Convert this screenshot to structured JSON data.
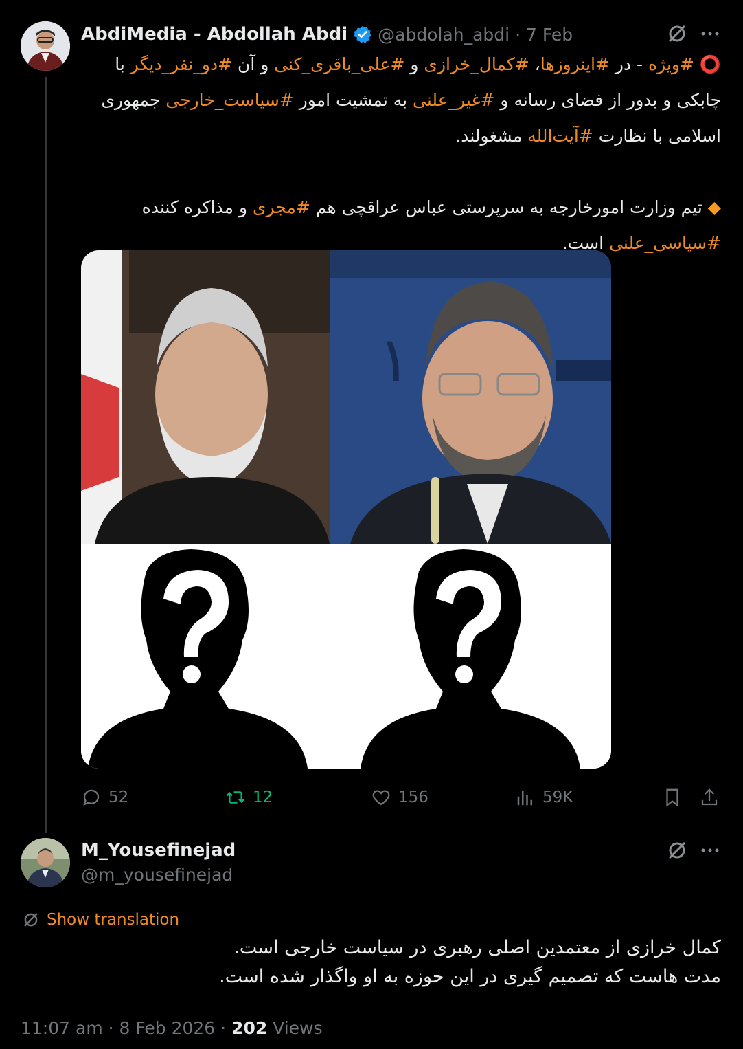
{
  "tweet": {
    "display_name": "AbdiMedia - Abdollah Abdi",
    "handle": "@abdolah_abdi",
    "dot": "·",
    "date": "7 Feb",
    "text": {
      "l1_icon": "⭕",
      "l1_a": " #ویژه",
      "l1_b": " -  در ",
      "l1_c": "#اینروزها",
      "l1_d": "، ",
      "l1_e": "#کمال_خرازی",
      "l1_f": " و ",
      "l1_g": "#علی_باقری_کنی",
      "l1_h": " و آن ",
      "l1_i": "#دو_نفر_دیگر",
      "l1_j": " با",
      "l2_a": "چابکی و بدور از فضای رسانه و ",
      "l2_b": "#غیر_علنی",
      "l2_c": " به تمشیت امور ",
      "l2_d": "#سیاست_خارجی",
      "l2_e": " جمهوری",
      "l3_a": "اسلامی با نظارت ",
      "l3_b": "#آیت‌الله",
      "l3_c": " مشغولند.",
      "l4_icon": "◆",
      "l4_a": " تیم وزارت امورخارجه به سرپرستی عباس عراقچی هم ",
      "l4_b": "#مجری",
      "l4_c": " و مذاکره کننده",
      "l5_a": "#سیاسی_علنی",
      "l5_b": " است."
    },
    "actions": {
      "replies": "52",
      "reposts": "12",
      "likes": "156",
      "views": "59K"
    }
  },
  "reply": {
    "display_name": "M_Yousefinejad",
    "handle": "@m_yousefinejad",
    "show_translation": "Show translation",
    "line1": "کمال خرازی از معتمدین اصلی رهبری در سیاست خارجی است.",
    "line2": "مدت هاست که تصمیم گیری در این حوزه به او واگذار شده است.",
    "time": "11:07 am",
    "dot": " · ",
    "date": "8 Feb 2026",
    "dot2": " · ",
    "views_count": "202",
    "views_label": " Views"
  },
  "icons": {
    "verified": "verified-badge-icon",
    "grok": "grok-icon",
    "more": "more-icon",
    "reply": "reply-icon",
    "repost": "repost-icon",
    "like": "like-icon",
    "views": "views-icon",
    "bookmark": "bookmark-icon",
    "share": "share-icon",
    "translate": "translate-icon"
  },
  "colors": {
    "background": "#000000",
    "text": "#e7e9ea",
    "muted": "#71767b",
    "hashtag": "#f08a24",
    "repost_active": "#00ba7c",
    "verified": "#1d9bf0"
  }
}
